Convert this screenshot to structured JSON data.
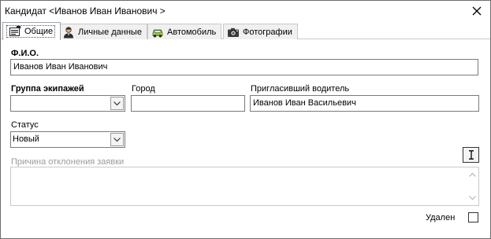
{
  "window": {
    "title": "Кандидат <Иванов Иван Иванович >"
  },
  "tabs": [
    {
      "label": "Общие",
      "icon": "general-form-icon",
      "active": true
    },
    {
      "label": "Личные данные",
      "icon": "person-icon",
      "active": false
    },
    {
      "label": "Автомобиль",
      "icon": "car-icon",
      "active": false
    },
    {
      "label": "Фотографии",
      "icon": "camera-icon",
      "active": false
    }
  ],
  "form": {
    "fio": {
      "label": "Ф.И.О.",
      "value": "Иванов Иван Иванович"
    },
    "crew_group": {
      "label": "Группа экипажей",
      "value": ""
    },
    "city": {
      "label": "Город",
      "value": ""
    },
    "inviting_driver": {
      "label": "Пригласивший водитель",
      "value": "Иванов Иван Васильевич"
    },
    "status": {
      "label": "Статус",
      "value": "Новый"
    },
    "rejection_reason": {
      "label": "Причина отклонения заявки",
      "value": ""
    },
    "deleted": {
      "label": "Удален",
      "checked": false
    }
  },
  "colors": {
    "border": "#7a7a7a",
    "disabled_text": "#9a9a9a",
    "tab_bg": "#f0f0f0"
  }
}
